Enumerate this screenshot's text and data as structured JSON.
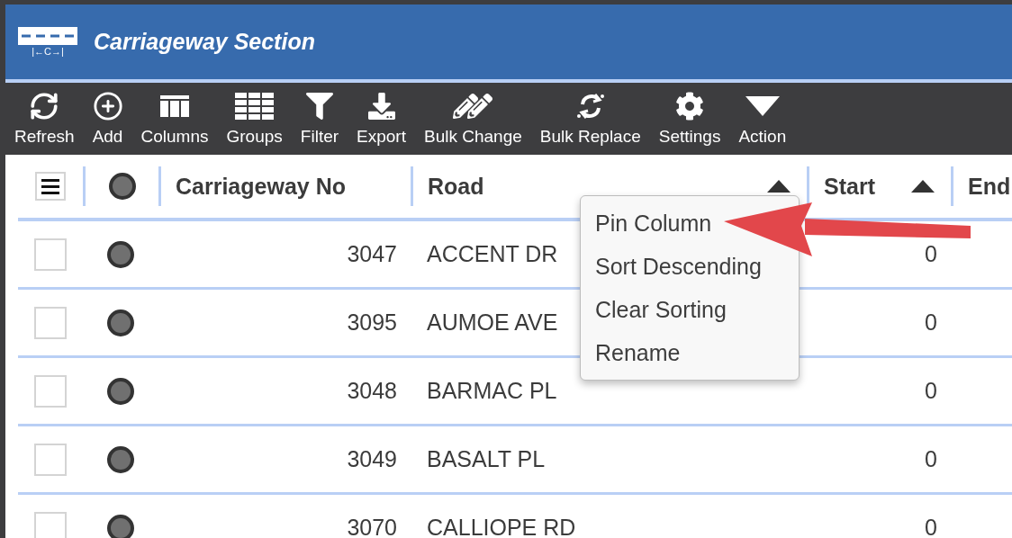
{
  "window": {
    "title": "Carriageway Section",
    "logo_label": "|←C→|"
  },
  "toolbar": [
    {
      "label": "Refresh"
    },
    {
      "label": "Add"
    },
    {
      "label": "Columns"
    },
    {
      "label": "Groups"
    },
    {
      "label": "Filter"
    },
    {
      "label": "Export"
    },
    {
      "label": "Bulk Change"
    },
    {
      "label": "Bulk Replace"
    },
    {
      "label": "Settings"
    },
    {
      "label": "Action"
    }
  ],
  "table": {
    "columns": [
      {
        "label": "Carriageway No",
        "sorted": false
      },
      {
        "label": "Road",
        "sorted": true
      },
      {
        "label": "Start",
        "sorted": true
      },
      {
        "label": "End",
        "sorted": false
      }
    ],
    "rows": [
      {
        "checked": false,
        "color": "#707070",
        "number": "3047",
        "road": "ACCENT DR",
        "start": "0"
      },
      {
        "checked": false,
        "color": "#707070",
        "number": "3095",
        "road": "AUMOE AVE",
        "start": "0"
      },
      {
        "checked": false,
        "color": "#707070",
        "number": "3048",
        "road": "BARMAC PL",
        "start": "0"
      },
      {
        "checked": false,
        "color": "#707070",
        "number": "3049",
        "road": "BASALT PL",
        "start": "0"
      },
      {
        "checked": false,
        "color": "#707070",
        "number": "3070",
        "road": "CALLIOPE RD",
        "start": "0"
      }
    ]
  },
  "context_menu": {
    "items": [
      {
        "label": "Pin Column"
      },
      {
        "label": "Sort Descending"
      },
      {
        "label": "Clear Sorting"
      },
      {
        "label": "Rename"
      }
    ]
  }
}
